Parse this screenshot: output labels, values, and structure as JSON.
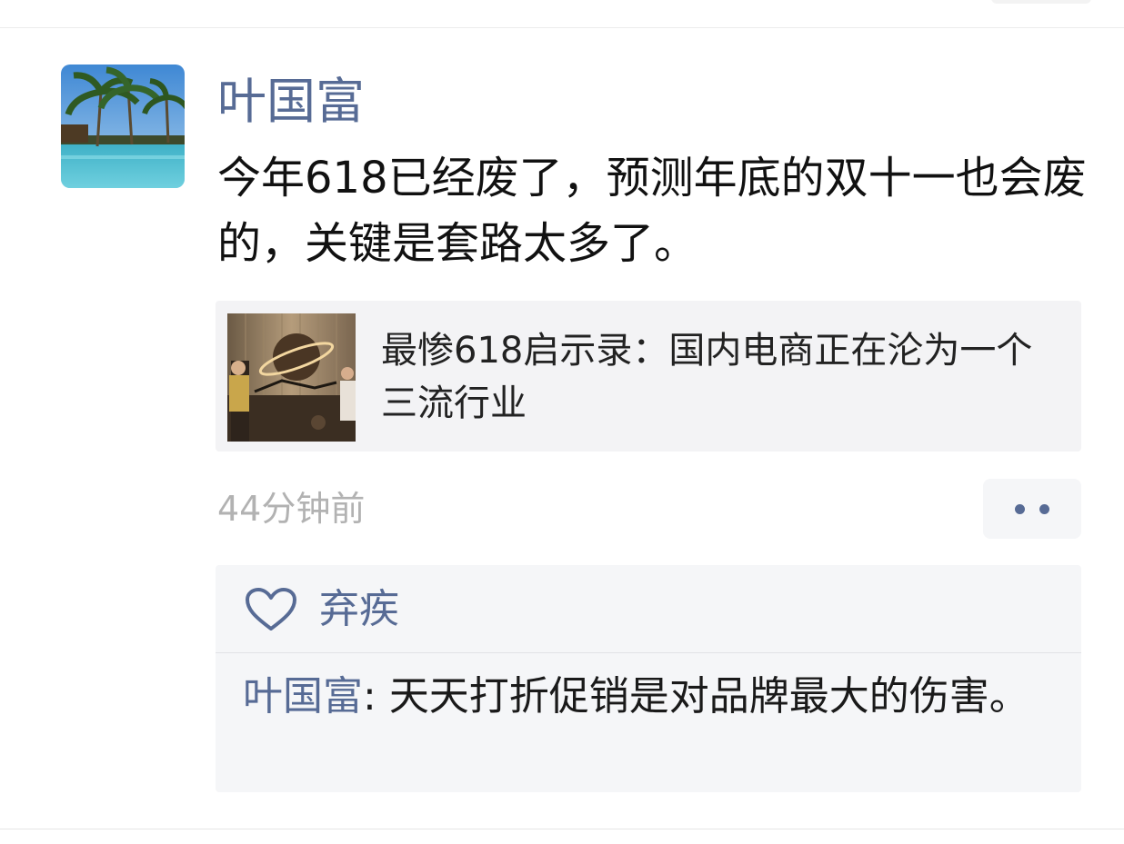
{
  "post": {
    "author": "叶国富",
    "text": "今年618已经废了，预测年底的双十一也会废的，关键是套路太多了。",
    "link": {
      "title": "最惨618启示录：国内电商正在沦为一个三流行业"
    },
    "timestamp": "44分钟前",
    "more_icon": "ellipsis-dots-icon"
  },
  "likes": {
    "icon": "heart-outline-icon",
    "names": "弃疾"
  },
  "comments": [
    {
      "author": "叶国富",
      "separator": ": ",
      "text": "天天打折促销是对品牌最大的伤害。"
    }
  ],
  "colors": {
    "link_blue": "#576b95",
    "timestamp_gray": "#b2b2b2",
    "card_bg": "#f3f3f5"
  }
}
